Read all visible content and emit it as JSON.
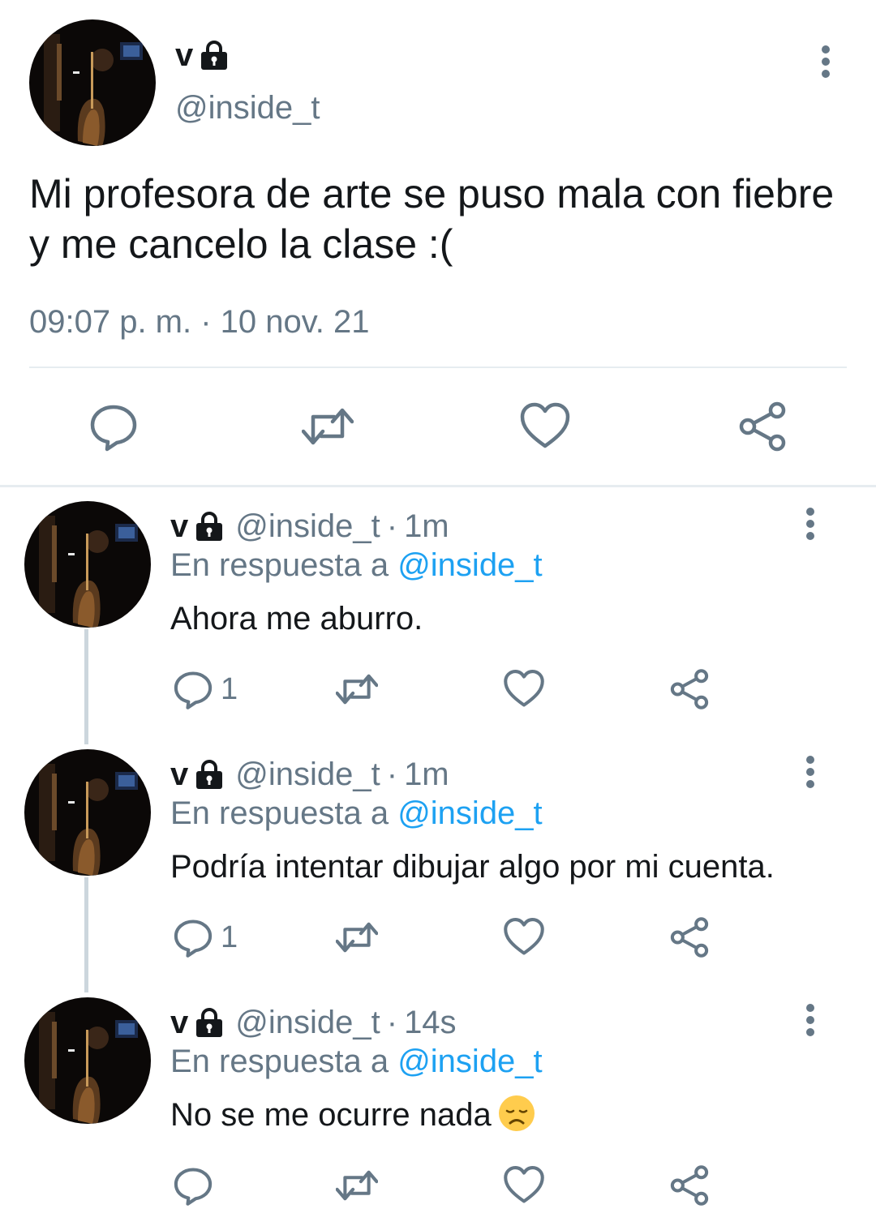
{
  "tweet": {
    "name": "v",
    "handle": "@inside_t",
    "text": "Mi profesora de arte se puso mala con fiebre y me cancelo la clase :(",
    "timestamp": "09:07 p. m. · 10 nov. 21",
    "actions": [
      "reply-icon",
      "retweet-icon",
      "like-icon",
      "share-icon"
    ]
  },
  "replies": [
    {
      "name": "v",
      "handle": "@inside_t",
      "dot": "·",
      "time": "1m",
      "reply_prefix": "En respuesta a",
      "reply_to": "@inside_t",
      "text": "Ahora me aburro.",
      "reply_count": "1"
    },
    {
      "name": "v",
      "handle": "@inside_t",
      "dot": "·",
      "time": "1m",
      "reply_prefix": "En respuesta a",
      "reply_to": "@inside_t",
      "text": "Podría intentar dibujar algo por mi cuenta.",
      "reply_count": "1"
    },
    {
      "name": "v",
      "handle": "@inside_t",
      "dot": "·",
      "time": "14s",
      "reply_prefix": "En respuesta a",
      "reply_to": "@inside_t",
      "text": "No se me ocurre nada",
      "emoji": "disappointed-face",
      "reply_count": ""
    }
  ],
  "colors": {
    "text": "#14171a",
    "secondary": "#657786",
    "accent": "#1da1f2",
    "divider": "#e6ecf0",
    "thread_line": "#ccd6dd"
  }
}
